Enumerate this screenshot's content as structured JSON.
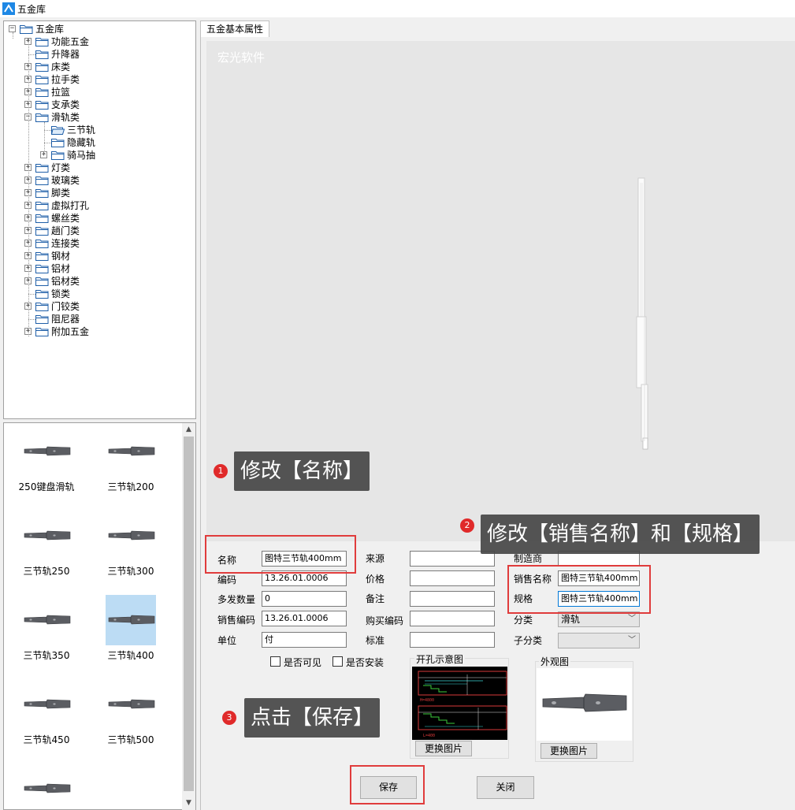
{
  "window": {
    "title": "五金库"
  },
  "tree": {
    "root": "五金库",
    "items": [
      {
        "label": "功能五金",
        "level": 1,
        "expandable": true
      },
      {
        "label": "升降器",
        "level": 1,
        "expandable": false
      },
      {
        "label": "床类",
        "level": 1,
        "expandable": true
      },
      {
        "label": "拉手类",
        "level": 1,
        "expandable": true
      },
      {
        "label": "拉篮",
        "level": 1,
        "expandable": true
      },
      {
        "label": "支承类",
        "level": 1,
        "expandable": true
      },
      {
        "label": "滑轨类",
        "level": 1,
        "expandable": true,
        "expanded": true
      },
      {
        "label": "三节轨",
        "level": 2,
        "expandable": false,
        "open": true
      },
      {
        "label": "隐藏轨",
        "level": 2,
        "expandable": false
      },
      {
        "label": "骑马抽",
        "level": 2,
        "expandable": true
      },
      {
        "label": "灯类",
        "level": 1,
        "expandable": true
      },
      {
        "label": "玻璃类",
        "level": 1,
        "expandable": true
      },
      {
        "label": "脚类",
        "level": 1,
        "expandable": true
      },
      {
        "label": "虚拟打孔",
        "level": 1,
        "expandable": true
      },
      {
        "label": "螺丝类",
        "level": 1,
        "expandable": true
      },
      {
        "label": "趟门类",
        "level": 1,
        "expandable": true
      },
      {
        "label": "连接类",
        "level": 1,
        "expandable": true
      },
      {
        "label": "钢材",
        "level": 1,
        "expandable": true
      },
      {
        "label": "铝材",
        "level": 1,
        "expandable": true
      },
      {
        "label": "铝材类",
        "level": 1,
        "expandable": true
      },
      {
        "label": "锁类",
        "level": 1,
        "expandable": false
      },
      {
        "label": "门铰类",
        "level": 1,
        "expandable": true
      },
      {
        "label": "阻尼器",
        "level": 1,
        "expandable": false
      },
      {
        "label": "附加五金",
        "level": 1,
        "expandable": true
      }
    ]
  },
  "thumbnails": [
    {
      "label": "250键盘滑轨",
      "selected": false
    },
    {
      "label": "三节轨200",
      "selected": false
    },
    {
      "label": "三节轨250",
      "selected": false
    },
    {
      "label": "三节轨300",
      "selected": false
    },
    {
      "label": "三节轨350",
      "selected": false
    },
    {
      "label": "三节轨400",
      "selected": true
    },
    {
      "label": "三节轨450",
      "selected": false
    },
    {
      "label": "三节轨500",
      "selected": false
    },
    {
      "label": "",
      "selected": false
    }
  ],
  "tab": {
    "label": "五金基本属性"
  },
  "preview": {
    "watermark": "宏光软件"
  },
  "form": {
    "name_label": "名称",
    "name_value": "图特三节轨400mm",
    "code_label": "编码",
    "code_value": "13.26.01.0006",
    "multi_qty_label": "多发数量",
    "multi_qty_value": "0",
    "sales_code_label": "销售编码",
    "sales_code_value": "13.26.01.0006",
    "unit_label": "单位",
    "unit_value": "付",
    "source_label": "来源",
    "source_value": "",
    "price_label": "价格",
    "price_value": "",
    "remark_label": "备注",
    "remark_value": "",
    "purchase_code_label": "购买编码",
    "purchase_code_value": "",
    "standard_label": "标准",
    "standard_value": "",
    "maker_label": "制造商",
    "maker_value": "",
    "sales_name_label": "销售名称",
    "sales_name_value": "图特三节轨400mm",
    "spec_label": "规格",
    "spec_value": "图特三节轨400mm",
    "category_label": "分类",
    "category_value": "滑轨",
    "subcategory_label": "子分类",
    "subcategory_value": "",
    "visible_label": "是否可见",
    "install_label": "是否安装",
    "hole_diagram_title": "开孔示意图",
    "appearance_title": "外观图",
    "change_image_label": "更换图片",
    "save_label": "保存",
    "close_label": "关闭"
  },
  "annotations": {
    "step1_num": "1",
    "step1_text": "修改【名称】",
    "step2_num": "2",
    "step2_text": "修改【销售名称】和【规格】",
    "step3_num": "3",
    "step3_text": "点击【保存】"
  },
  "colors": {
    "accent": "#e03c3c",
    "selection": "#bcdcf4",
    "callout_bg": "#464646",
    "focus_border": "#0078d7"
  }
}
